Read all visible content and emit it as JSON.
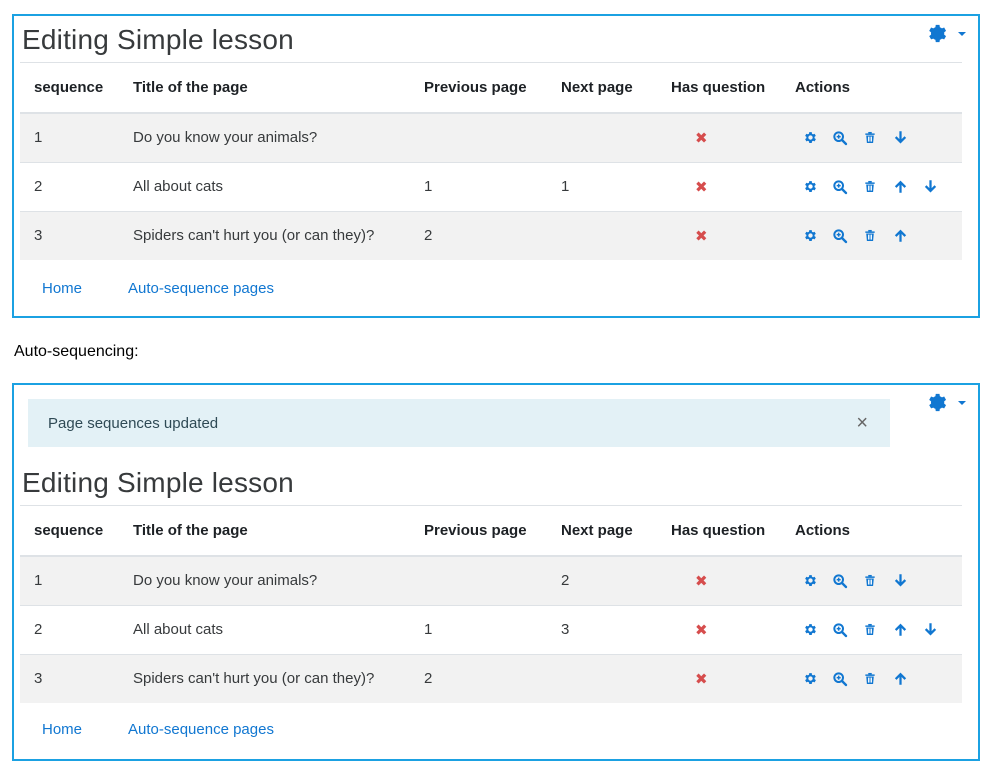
{
  "panels": [
    {
      "heading": "Editing Simple lesson",
      "columns": [
        "sequence",
        "Title of the page",
        "Previous page",
        "Next page",
        "Has question",
        "Actions"
      ],
      "rows": [
        {
          "seq": "1",
          "title": "Do you know your animals?",
          "prev": "",
          "next": "",
          "hasq": "✖",
          "actions": [
            "gear",
            "zoom",
            "trash",
            "down"
          ]
        },
        {
          "seq": "2",
          "title": "All about cats",
          "prev": "1",
          "next": "1",
          "hasq": "✖",
          "actions": [
            "gear",
            "zoom",
            "trash",
            "up",
            "down"
          ]
        },
        {
          "seq": "3",
          "title": "Spiders can't hurt you (or can they)?",
          "prev": "2",
          "next": "",
          "hasq": "✖",
          "actions": [
            "gear",
            "zoom",
            "trash",
            "up"
          ]
        }
      ],
      "links": {
        "home": "Home",
        "auto": "Auto-sequence pages"
      }
    },
    {
      "alert": {
        "message": "Page sequences updated",
        "close": "×"
      },
      "heading": "Editing Simple lesson",
      "columns": [
        "sequence",
        "Title of the page",
        "Previous page",
        "Next page",
        "Has question",
        "Actions"
      ],
      "rows": [
        {
          "seq": "1",
          "title": "Do you know your animals?",
          "prev": "",
          "next": "2",
          "hasq": "✖",
          "actions": [
            "gear",
            "zoom",
            "trash",
            "down"
          ]
        },
        {
          "seq": "2",
          "title": "All about cats",
          "prev": "1",
          "next": "3",
          "hasq": "✖",
          "actions": [
            "gear",
            "zoom",
            "trash",
            "up",
            "down"
          ]
        },
        {
          "seq": "3",
          "title": "Spiders can't hurt you (or can they)?",
          "prev": "2",
          "next": "",
          "hasq": "✖",
          "actions": [
            "gear",
            "zoom",
            "trash",
            "up"
          ]
        }
      ],
      "links": {
        "home": "Home",
        "auto": "Auto-sequence pages"
      }
    }
  ],
  "between_label": "Auto-sequencing:",
  "colors": {
    "border": "#1ba1e2",
    "link": "#1177d1",
    "icon": "#1177d1",
    "xmark": "#d64d4d",
    "alert_bg": "#e3f1f6"
  },
  "icons": {
    "menu": "gear-icon",
    "gear": "gear-icon",
    "zoom": "zoom-in-icon",
    "trash": "trash-icon",
    "up": "arrow-up-icon",
    "down": "arrow-down-icon"
  }
}
